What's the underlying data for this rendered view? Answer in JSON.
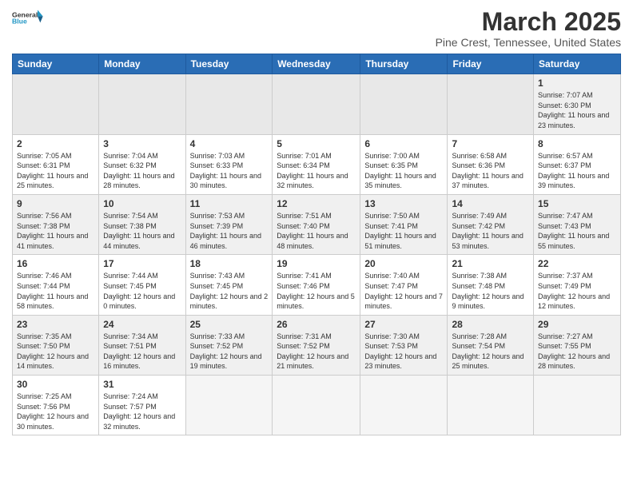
{
  "header": {
    "logo_general": "General",
    "logo_blue": "Blue",
    "month": "March 2025",
    "location": "Pine Crest, Tennessee, United States"
  },
  "days_of_week": [
    "Sunday",
    "Monday",
    "Tuesday",
    "Wednesday",
    "Thursday",
    "Friday",
    "Saturday"
  ],
  "weeks": [
    [
      {
        "day": "",
        "info": ""
      },
      {
        "day": "",
        "info": ""
      },
      {
        "day": "",
        "info": ""
      },
      {
        "day": "",
        "info": ""
      },
      {
        "day": "",
        "info": ""
      },
      {
        "day": "",
        "info": ""
      },
      {
        "day": "1",
        "info": "Sunrise: 7:07 AM\nSunset: 6:30 PM\nDaylight: 11 hours and 23 minutes."
      }
    ],
    [
      {
        "day": "2",
        "info": "Sunrise: 7:05 AM\nSunset: 6:31 PM\nDaylight: 11 hours and 25 minutes."
      },
      {
        "day": "3",
        "info": "Sunrise: 7:04 AM\nSunset: 6:32 PM\nDaylight: 11 hours and 28 minutes."
      },
      {
        "day": "4",
        "info": "Sunrise: 7:03 AM\nSunset: 6:33 PM\nDaylight: 11 hours and 30 minutes."
      },
      {
        "day": "5",
        "info": "Sunrise: 7:01 AM\nSunset: 6:34 PM\nDaylight: 11 hours and 32 minutes."
      },
      {
        "day": "6",
        "info": "Sunrise: 7:00 AM\nSunset: 6:35 PM\nDaylight: 11 hours and 35 minutes."
      },
      {
        "day": "7",
        "info": "Sunrise: 6:58 AM\nSunset: 6:36 PM\nDaylight: 11 hours and 37 minutes."
      },
      {
        "day": "8",
        "info": "Sunrise: 6:57 AM\nSunset: 6:37 PM\nDaylight: 11 hours and 39 minutes."
      }
    ],
    [
      {
        "day": "9",
        "info": "Sunrise: 7:56 AM\nSunset: 7:38 PM\nDaylight: 11 hours and 41 minutes."
      },
      {
        "day": "10",
        "info": "Sunrise: 7:54 AM\nSunset: 7:38 PM\nDaylight: 11 hours and 44 minutes."
      },
      {
        "day": "11",
        "info": "Sunrise: 7:53 AM\nSunset: 7:39 PM\nDaylight: 11 hours and 46 minutes."
      },
      {
        "day": "12",
        "info": "Sunrise: 7:51 AM\nSunset: 7:40 PM\nDaylight: 11 hours and 48 minutes."
      },
      {
        "day": "13",
        "info": "Sunrise: 7:50 AM\nSunset: 7:41 PM\nDaylight: 11 hours and 51 minutes."
      },
      {
        "day": "14",
        "info": "Sunrise: 7:49 AM\nSunset: 7:42 PM\nDaylight: 11 hours and 53 minutes."
      },
      {
        "day": "15",
        "info": "Sunrise: 7:47 AM\nSunset: 7:43 PM\nDaylight: 11 hours and 55 minutes."
      }
    ],
    [
      {
        "day": "16",
        "info": "Sunrise: 7:46 AM\nSunset: 7:44 PM\nDaylight: 11 hours and 58 minutes."
      },
      {
        "day": "17",
        "info": "Sunrise: 7:44 AM\nSunset: 7:45 PM\nDaylight: 12 hours and 0 minutes."
      },
      {
        "day": "18",
        "info": "Sunrise: 7:43 AM\nSunset: 7:45 PM\nDaylight: 12 hours and 2 minutes."
      },
      {
        "day": "19",
        "info": "Sunrise: 7:41 AM\nSunset: 7:46 PM\nDaylight: 12 hours and 5 minutes."
      },
      {
        "day": "20",
        "info": "Sunrise: 7:40 AM\nSunset: 7:47 PM\nDaylight: 12 hours and 7 minutes."
      },
      {
        "day": "21",
        "info": "Sunrise: 7:38 AM\nSunset: 7:48 PM\nDaylight: 12 hours and 9 minutes."
      },
      {
        "day": "22",
        "info": "Sunrise: 7:37 AM\nSunset: 7:49 PM\nDaylight: 12 hours and 12 minutes."
      }
    ],
    [
      {
        "day": "23",
        "info": "Sunrise: 7:35 AM\nSunset: 7:50 PM\nDaylight: 12 hours and 14 minutes."
      },
      {
        "day": "24",
        "info": "Sunrise: 7:34 AM\nSunset: 7:51 PM\nDaylight: 12 hours and 16 minutes."
      },
      {
        "day": "25",
        "info": "Sunrise: 7:33 AM\nSunset: 7:52 PM\nDaylight: 12 hours and 19 minutes."
      },
      {
        "day": "26",
        "info": "Sunrise: 7:31 AM\nSunset: 7:52 PM\nDaylight: 12 hours and 21 minutes."
      },
      {
        "day": "27",
        "info": "Sunrise: 7:30 AM\nSunset: 7:53 PM\nDaylight: 12 hours and 23 minutes."
      },
      {
        "day": "28",
        "info": "Sunrise: 7:28 AM\nSunset: 7:54 PM\nDaylight: 12 hours and 25 minutes."
      },
      {
        "day": "29",
        "info": "Sunrise: 7:27 AM\nSunset: 7:55 PM\nDaylight: 12 hours and 28 minutes."
      }
    ],
    [
      {
        "day": "30",
        "info": "Sunrise: 7:25 AM\nSunset: 7:56 PM\nDaylight: 12 hours and 30 minutes."
      },
      {
        "day": "31",
        "info": "Sunrise: 7:24 AM\nSunset: 7:57 PM\nDaylight: 12 hours and 32 minutes."
      },
      {
        "day": "",
        "info": ""
      },
      {
        "day": "",
        "info": ""
      },
      {
        "day": "",
        "info": ""
      },
      {
        "day": "",
        "info": ""
      },
      {
        "day": "",
        "info": ""
      }
    ]
  ]
}
